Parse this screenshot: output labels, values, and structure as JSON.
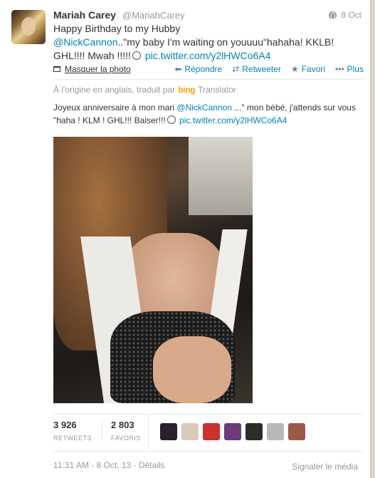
{
  "tweet": {
    "name": "Mariah Carey",
    "handle": "@MariahCarey",
    "date": "8 Oct",
    "line1": "Happy Birthday to my Hubby",
    "mention": "@NickCannon",
    "text_rest": "..\"my baby I'm waiting on youuuu\"hahaha! KKLB! GHL!!!! Mwah !!!!!",
    "pic_link": "pic.twitter.com/y2lHWCo6A4"
  },
  "actions": {
    "hide_photo": "Masquer la photo",
    "reply": "Répondre",
    "retweet": "Retweeter",
    "favorite": "Favori",
    "more": "Plus"
  },
  "translation": {
    "notice": "À l'origine en anglais, traduit par",
    "provider": "bing",
    "provider_suffix": "Translator",
    "text_before": "Joyeux anniversaire à mon mari ",
    "mention": "@NickCannon",
    "text_after": " ...\" mon bébé, j'attends sur vous \"haha ! KLM ! GHL!!! Baiser!!!",
    "pic_link": "pic.twitter.com/y2lHWCo6A4"
  },
  "stats": {
    "retweets_count": "3 926",
    "retweets_label": "RETWEETS",
    "favorites_count": "2 803",
    "favorites_label": "FAVORIS"
  },
  "favoriters": [
    {
      "name": "avatar-1",
      "color": "#2a1f2e"
    },
    {
      "name": "avatar-2",
      "color": "#d9cbb9"
    },
    {
      "name": "avatar-3",
      "color": "#c8312d"
    },
    {
      "name": "avatar-4",
      "color": "#6b3b7a"
    },
    {
      "name": "avatar-5",
      "color": "#2b2b2b"
    },
    {
      "name": "avatar-6",
      "color": "#b9b9b9"
    },
    {
      "name": "avatar-7",
      "color": "#9a5a4a"
    }
  ],
  "footer": {
    "timestamp": "11:31 AM - 8 Oct, 13",
    "sep": " · ",
    "details": "Détails",
    "report": "Signaler le média"
  },
  "colors": {
    "link": "#0084b4",
    "muted": "#999999"
  }
}
